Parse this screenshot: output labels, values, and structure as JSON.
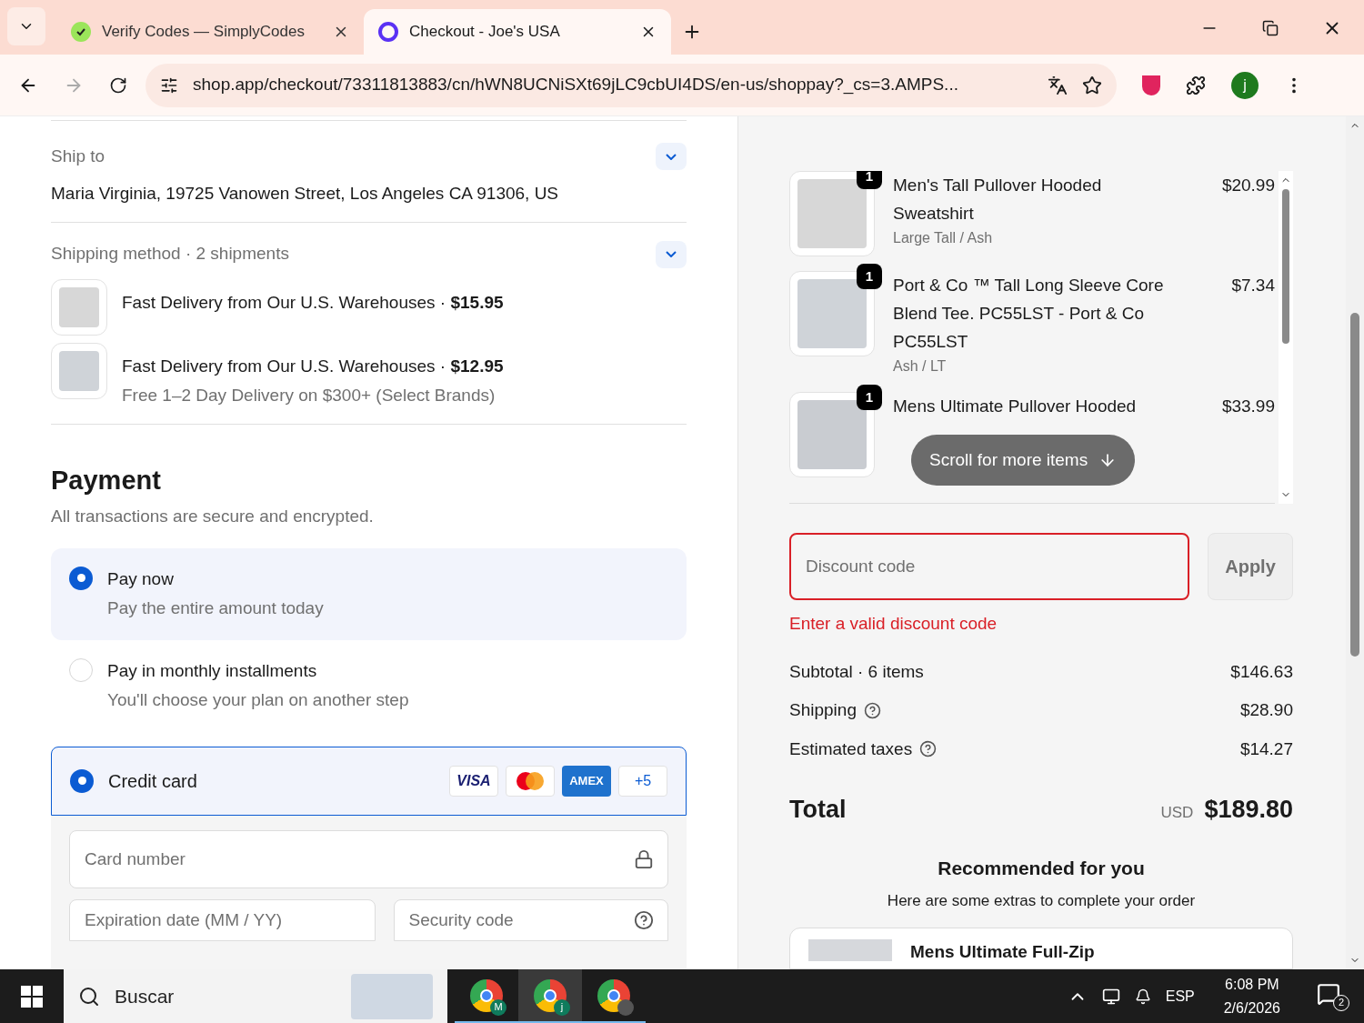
{
  "browser": {
    "tabs": [
      {
        "title": "Verify Codes — SimplyCodes",
        "kind": "simplycodes",
        "selected": false
      },
      {
        "title": "Checkout - Joe's USA",
        "kind": "shop",
        "selected": true
      }
    ],
    "url": "shop.app/checkout/73311813883/cn/hWN8UCNiSXt69jLC9cbUI4DS/en-us/shoppay?_cs=3.AMPS...",
    "profile_initial": "j"
  },
  "ship_to": {
    "label": "Ship to",
    "address": "Maria Virginia, 19725 Vanowen Street, Los Angeles CA 91306, US"
  },
  "shipping": {
    "label": "Shipping method · 2 shipments",
    "shipments": [
      {
        "text": "Fast Delivery from Our U.S. Warehouses · ",
        "price": "$15.95",
        "kind": "hoodie"
      },
      {
        "text": "Fast Delivery from Our U.S. Warehouses · ",
        "price": "$12.95",
        "note": "Free 1–2 Day Delivery on $300+ (Select Brands)",
        "kind": "tee"
      }
    ]
  },
  "payment": {
    "title": "Payment",
    "subtitle": "All transactions are secure and encrypted.",
    "options": [
      {
        "label": "Pay now",
        "description": "Pay the entire amount today",
        "selected": true
      },
      {
        "label": "Pay in monthly installments",
        "description": "You'll choose your plan on another step",
        "selected": false
      }
    ],
    "method": {
      "label": "Credit card",
      "selected": true,
      "brands": [
        {
          "kind": "visa",
          "label": "VISA"
        },
        {
          "kind": "mastercard"
        },
        {
          "kind": "amex",
          "label": "AMEX"
        },
        {
          "kind": "more",
          "label": "+5"
        }
      ]
    },
    "card_number": {
      "placeholder": "Card number"
    },
    "expiration": {
      "placeholder": "Expiration date (MM / YY)"
    },
    "security": {
      "placeholder": "Security code"
    }
  },
  "summary": {
    "items": [
      {
        "quantity": "1",
        "name": "Men's Tall Pullover Hooded Sweatshirt",
        "variant": "Large Tall / Ash",
        "price": "$20.99",
        "kind": "hoodie"
      },
      {
        "quantity": "1",
        "name": "Port & Co ™ Tall Long Sleeve Core Blend Tee. PC55LST - Port & Co PC55LST",
        "variant": "Ash / LT",
        "price": "$7.34",
        "kind": "tee"
      },
      {
        "quantity": "1",
        "name": "Mens Ultimate Pullover Hooded",
        "price": "$33.99",
        "kind": "model"
      }
    ],
    "scroll_hint": "Scroll for more items",
    "discount": {
      "placeholder": "Discount code",
      "error": "Enter a valid discount code",
      "button": "Apply"
    },
    "rows": [
      {
        "label": "Subtotal · 6 items",
        "value": "$146.63",
        "help": false
      },
      {
        "label": "Shipping",
        "value": "$28.90",
        "help": true
      },
      {
        "label": "Estimated taxes",
        "value": "$14.27",
        "help": true
      }
    ],
    "total": {
      "label": "Total",
      "currency": "USD",
      "amount": "$189.80"
    },
    "recommended": {
      "title": "Recommended for you",
      "subtitle": "Here are some extras to complete your order",
      "items": [
        {
          "name": "Mens Ultimate Full-Zip"
        }
      ]
    }
  },
  "taskbar": {
    "search": "Buscar",
    "apps": [
      {
        "badge": "M",
        "selected": false
      },
      {
        "badge": "j",
        "selected": true
      },
      {
        "selected": false
      }
    ],
    "language": "ESP",
    "time": "6:08 PM",
    "date": "2/6/2026",
    "notifications": "2"
  }
}
